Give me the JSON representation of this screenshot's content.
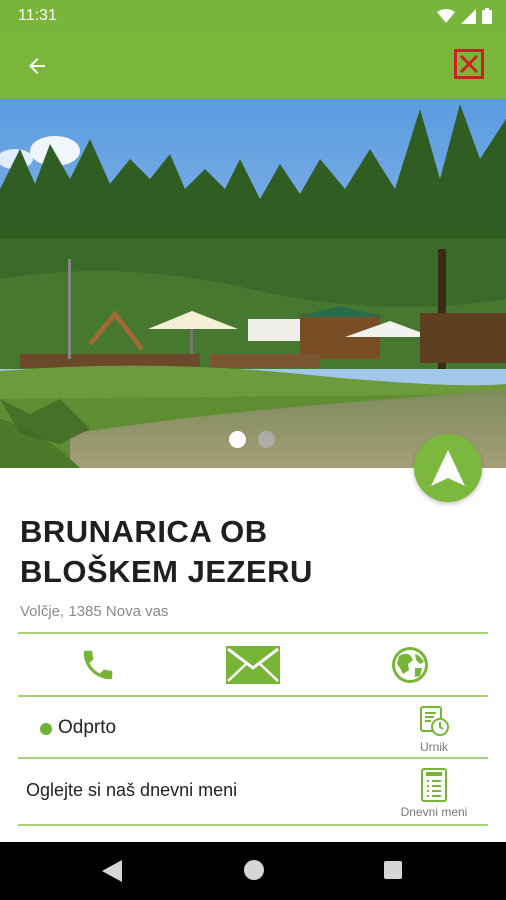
{
  "status_bar": {
    "time": "11:31",
    "icons": [
      "wifi-icon",
      "signal-icon",
      "battery-icon"
    ]
  },
  "app_bar": {
    "back_icon": "arrow-left-icon",
    "close_icon": "close-icon",
    "color": "#79b63a"
  },
  "hero": {
    "image_count": 2,
    "active_index": 0
  },
  "venue": {
    "name": "BRUNARICA OB BLOŠKEM JEZERU",
    "address": "Volčje, 1385 Nova vas"
  },
  "contact": {
    "phone_icon": "phone-icon",
    "email_icon": "envelope-icon",
    "web_icon": "globe-icon"
  },
  "hours": {
    "status": "Odprto",
    "status_color": "#6fb032",
    "schedule_label": "Urnik"
  },
  "menu": {
    "text": "Oglejte si naš dnevni meni",
    "button_label": "Dnevni meni"
  },
  "colors": {
    "accent": "#79b63a",
    "divider": "#a8d27a"
  }
}
